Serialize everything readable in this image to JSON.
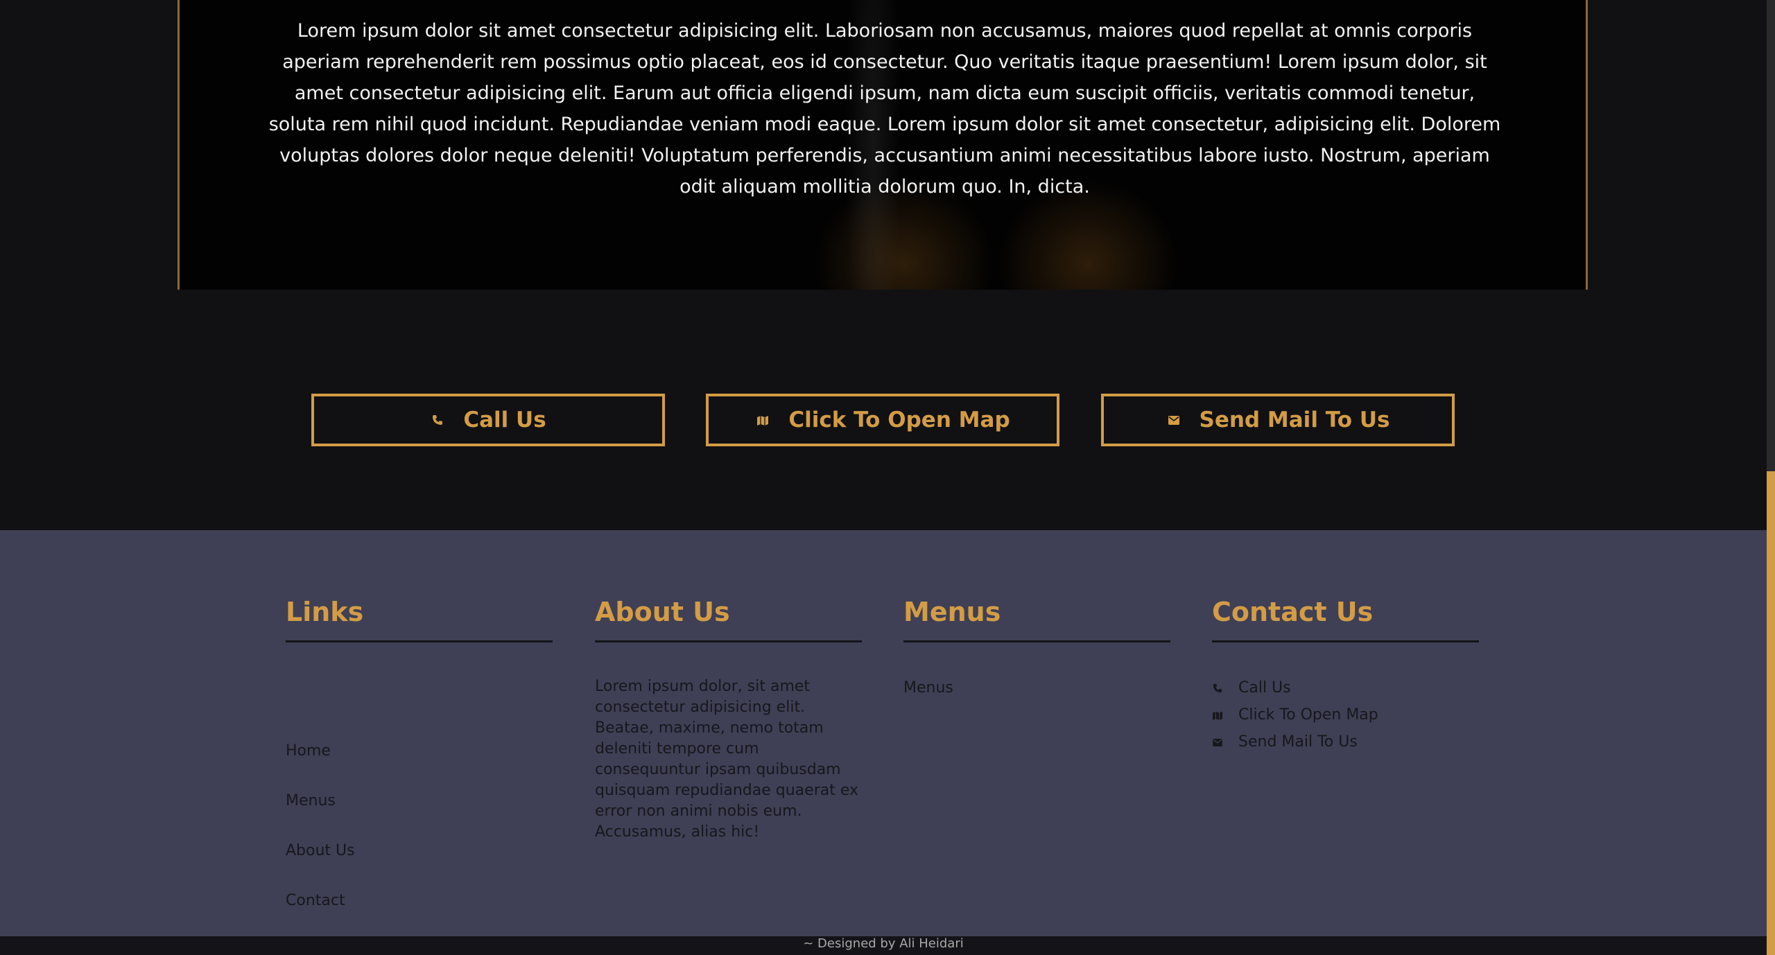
{
  "hero": {
    "text": "Lorem ipsum dolor sit amet consectetur adipisicing elit. Laboriosam non accusamus, maiores quod repellat at omnis corporis aperiam reprehenderit rem possimus optio placeat, eos id consectetur. Quo veritatis itaque praesentium! Lorem ipsum dolor, sit amet consectetur adipisicing elit. Earum aut officia eligendi ipsum, nam dicta eum suscipit officiis, veritatis commodi tenetur, soluta rem nihil quod incidunt. Repudiandae veniam modi eaque. Lorem ipsum dolor sit amet consectetur, adipisicing elit. Dolorem voluptas dolores dolor neque deleniti! Voluptatum perferendis, accusantium animi necessitatibus labore iusto. Nostrum, aperiam odit aliquam mollitia dolorum quo. In, dicta."
  },
  "cta": {
    "call": {
      "label": "Call Us",
      "icon": "phone-icon"
    },
    "map": {
      "label": "Click To Open Map",
      "icon": "map-icon"
    },
    "mail": {
      "label": "Send Mail To Us",
      "icon": "envelope-icon"
    }
  },
  "footer": {
    "links": {
      "title": "Links",
      "items": [
        "Home",
        "Menus",
        "About Us",
        "Contact"
      ]
    },
    "about": {
      "title": "About Us",
      "text": "Lorem ipsum dolor, sit amet consectetur adipisicing elit. Beatae, maxime, nemo totam deleniti tempore cum consequuntur ipsam quibusdam quisquam repudiandae quaerat ex error non animi nobis eum. Accusamus, alias hic!"
    },
    "menus": {
      "title": "Menus",
      "items": [
        "Menus"
      ]
    },
    "contact": {
      "title": "Contact Us",
      "items": [
        {
          "label": "Call Us",
          "icon": "phone-icon"
        },
        {
          "label": "Click To Open Map",
          "icon": "map-icon"
        },
        {
          "label": "Send Mail To Us",
          "icon": "envelope-icon"
        }
      ]
    }
  },
  "credits": {
    "text": "~ Designed by Ali Heidari"
  },
  "colors": {
    "accent": "#d39c45",
    "page_bg": "#111113",
    "footer_bg": "#3f4055",
    "text_dark": "#17171c",
    "text_light": "#f2f2f2"
  }
}
